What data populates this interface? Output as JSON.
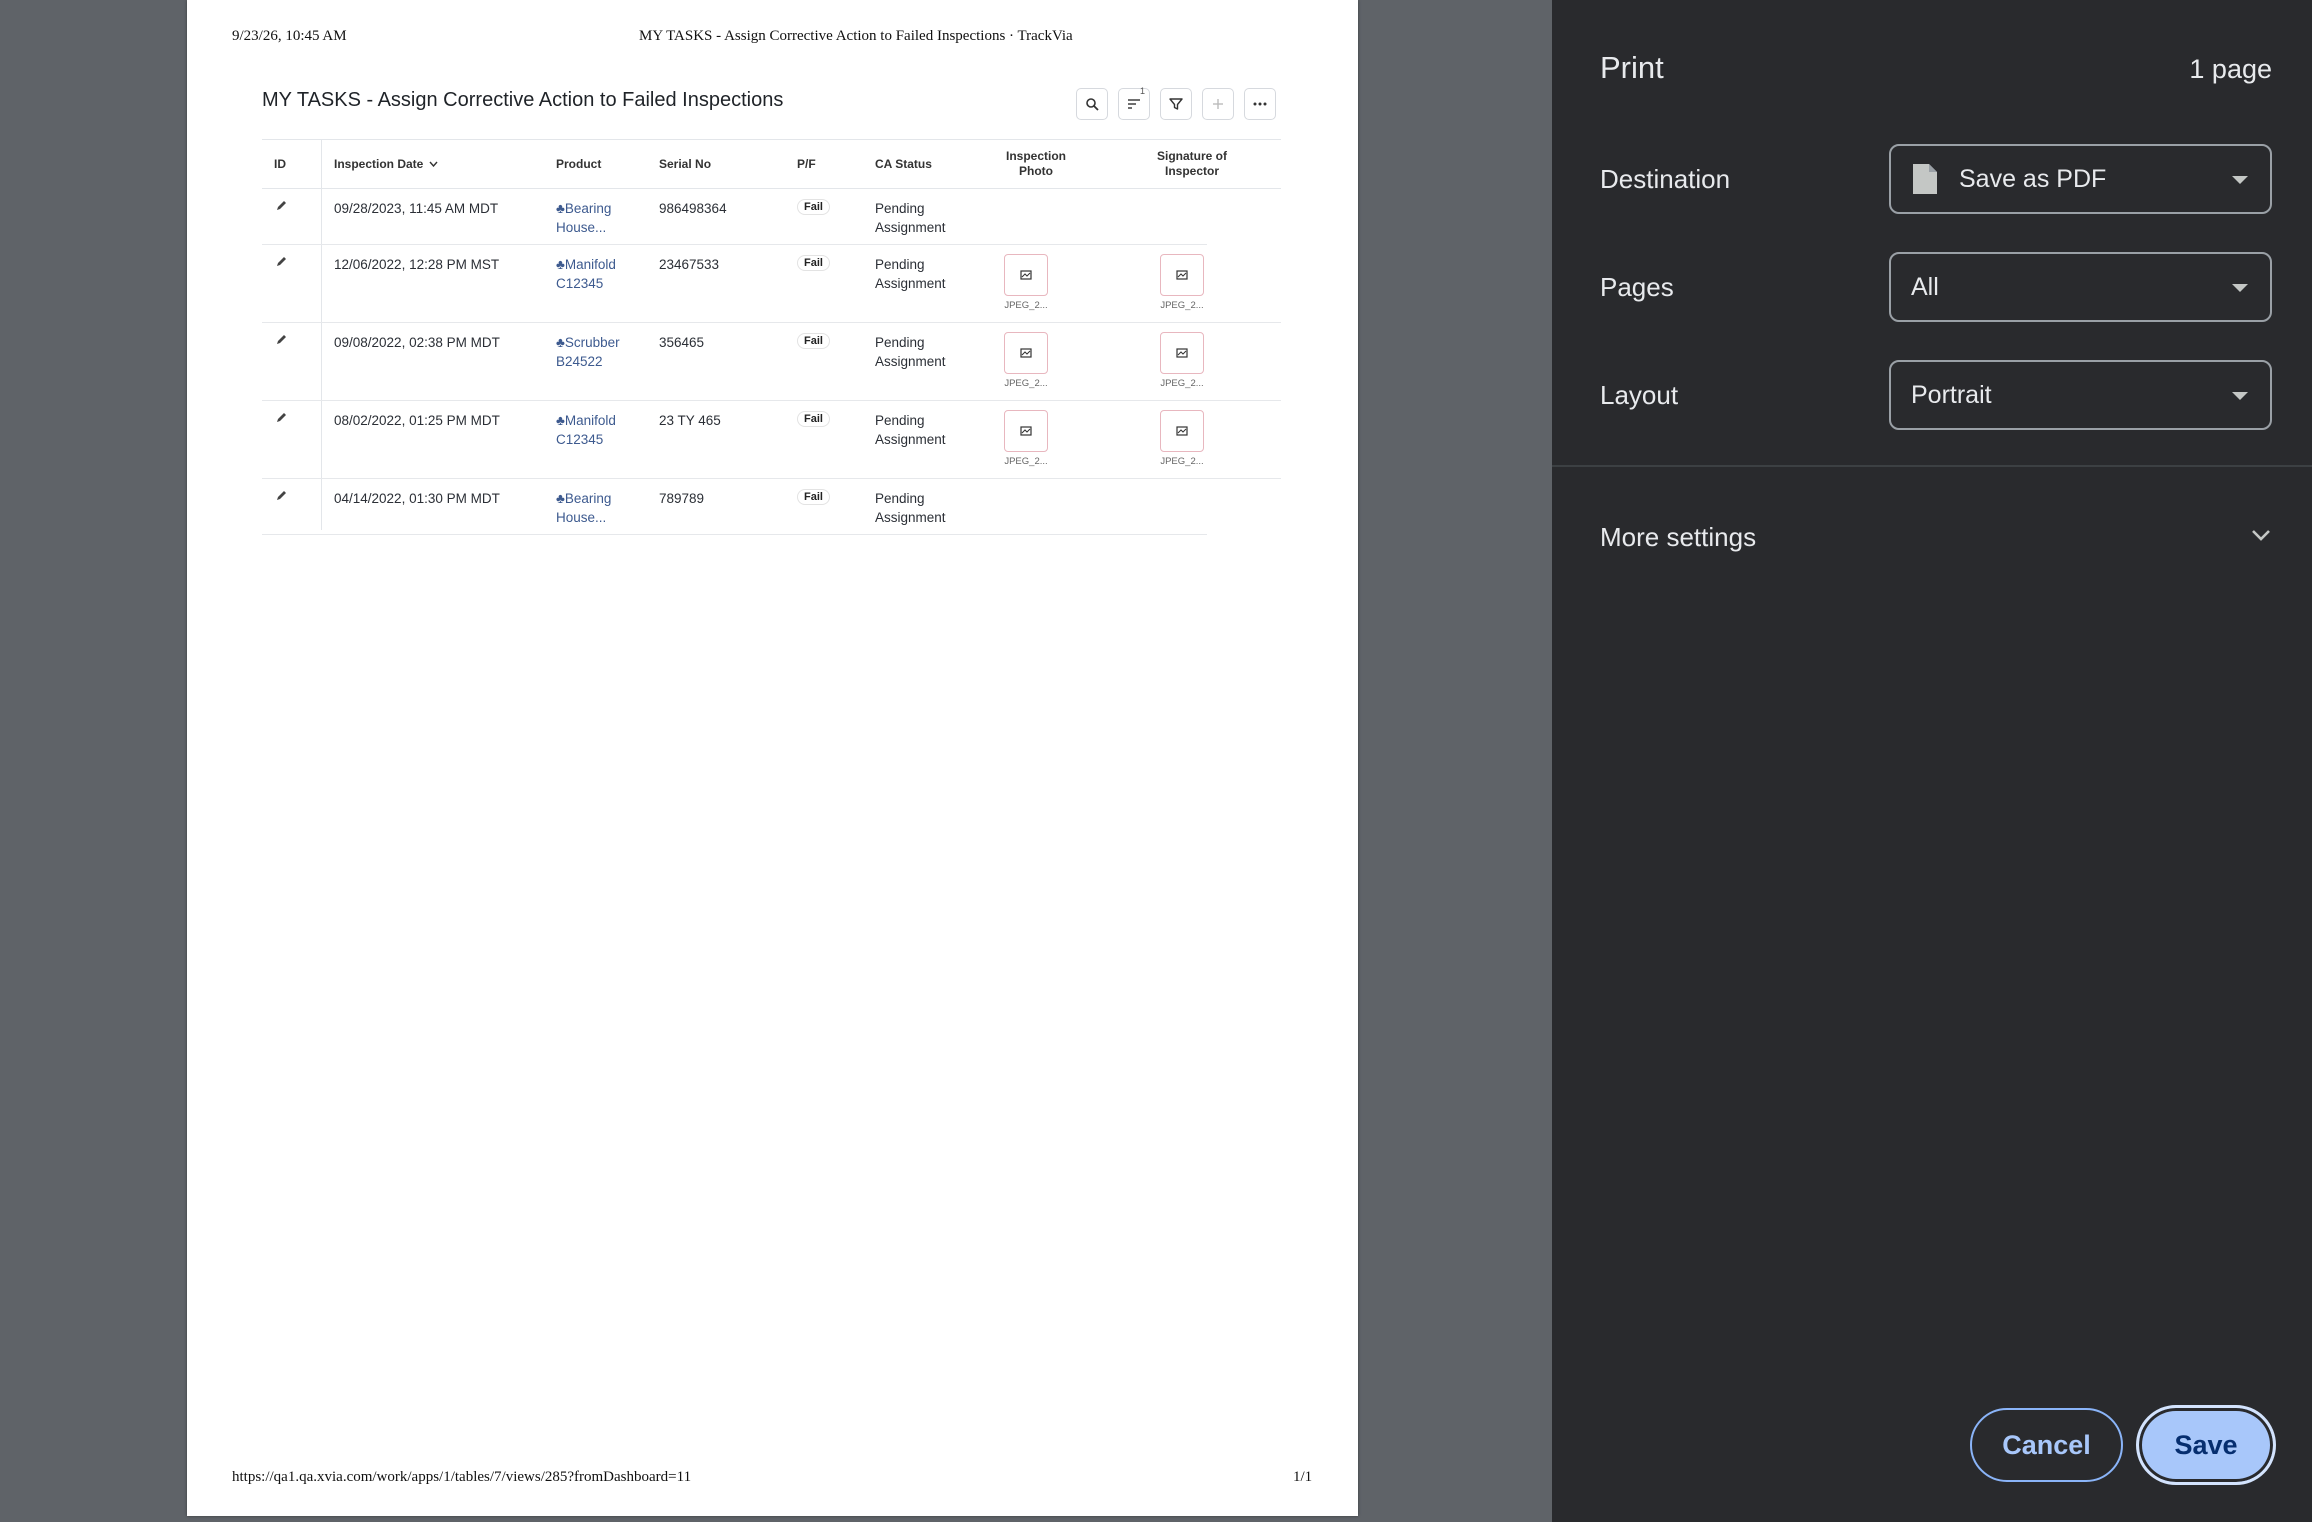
{
  "page": {
    "header_date": "9/23/26, 10:45 AM",
    "header_title": "MY TASKS - Assign Corrective Action to Failed Inspections · TrackVia",
    "footer_url": "https://qa1.qa.xvia.com/work/apps/1/tables/7/views/285?fromDashboard=11",
    "footer_pages": "1/1"
  },
  "view": {
    "title": "MY TASKS - Assign Corrective Action to Failed Inspections",
    "sort_badge": "1",
    "toolbar_icons": [
      "search-icon",
      "sort-icon",
      "filter-icon",
      "plus-icon",
      "more-icon"
    ]
  },
  "table": {
    "columns": {
      "id": "ID",
      "inspection_date": "Inspection Date",
      "product": "Product",
      "serial_no": "Serial No",
      "pf": "P/F",
      "ca_status": "CA Status",
      "photo_line1": "Inspection",
      "photo_line2": "Photo",
      "sig_line1": "Signature of",
      "sig_line2": "Inspector"
    },
    "rows": [
      {
        "date": "09/28/2023, 11:45 AM MDT",
        "product1": "Bearing",
        "product2": "House...",
        "serial": "986498364",
        "pf": "Fail",
        "status1": "Pending",
        "status2": "Assignment",
        "photo": "",
        "signature": ""
      },
      {
        "date": "12/06/2022, 12:28 PM MST",
        "product1": "Manifold",
        "product2": "C12345",
        "serial": "23467533",
        "pf": "Fail",
        "status1": "Pending",
        "status2": "Assignment",
        "photo": "JPEG_2...",
        "signature": "JPEG_2..."
      },
      {
        "date": "09/08/2022, 02:38 PM MDT",
        "product1": "Scrubber",
        "product2": "B24522",
        "serial": "356465",
        "pf": "Fail",
        "status1": "Pending",
        "status2": "Assignment",
        "photo": "JPEG_2...",
        "signature": "JPEG_2..."
      },
      {
        "date": "08/02/2022, 01:25 PM MDT",
        "product1": "Manifold",
        "product2": "C12345",
        "serial": "23 TY 465",
        "pf": "Fail",
        "status1": "Pending",
        "status2": "Assignment",
        "photo": "JPEG_2...",
        "signature": "JPEG_2..."
      },
      {
        "date": "04/14/2022, 01:30 PM MDT",
        "product1": "Bearing",
        "product2": "House...",
        "serial": "789789",
        "pf": "Fail",
        "status1": "Pending",
        "status2": "Assignment",
        "photo": "",
        "signature": ""
      }
    ]
  },
  "print_panel": {
    "title": "Print",
    "page_count": "1 page",
    "destination_label": "Destination",
    "destination_value": "Save as PDF",
    "pages_label": "Pages",
    "pages_value": "All",
    "layout_label": "Layout",
    "layout_value": "Portrait",
    "more_settings": "More settings",
    "cancel": "Cancel",
    "save": "Save"
  },
  "colors": {
    "panel_bg": "#292a2d",
    "save_bg": "#a8c7fa",
    "link": "#3d5a8f",
    "preview_bg": "#5f6368"
  }
}
